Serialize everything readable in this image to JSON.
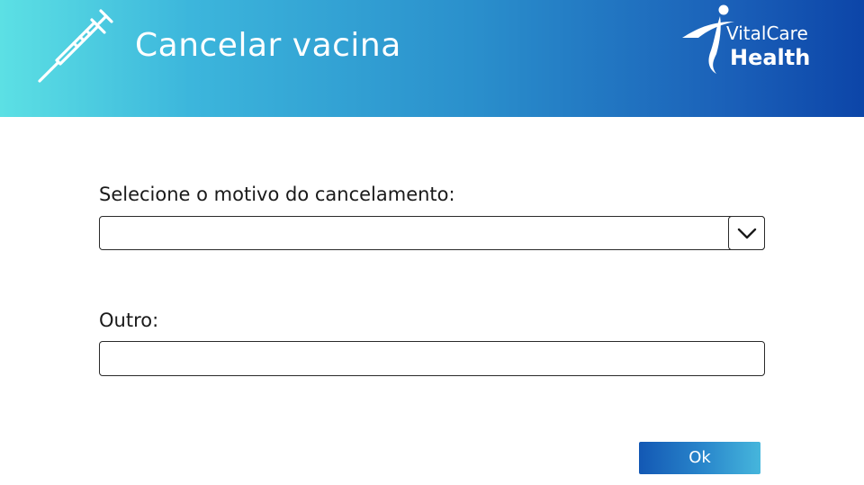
{
  "header": {
    "title": "Cancelar vacina",
    "icon": "syringe-icon",
    "brand": {
      "line1": "VitalCare",
      "line2": "Health"
    },
    "gradient_colors": [
      "#5ce0e4",
      "#2a8fcc",
      "#0c45a8"
    ]
  },
  "form": {
    "reason": {
      "label": "Selecione o motivo do cancelamento:",
      "selected_value": "",
      "toggle_icon": "chevron-down-icon"
    },
    "other": {
      "label": "Outro:",
      "value": "",
      "placeholder": ""
    }
  },
  "actions": {
    "ok_label": "Ok"
  }
}
